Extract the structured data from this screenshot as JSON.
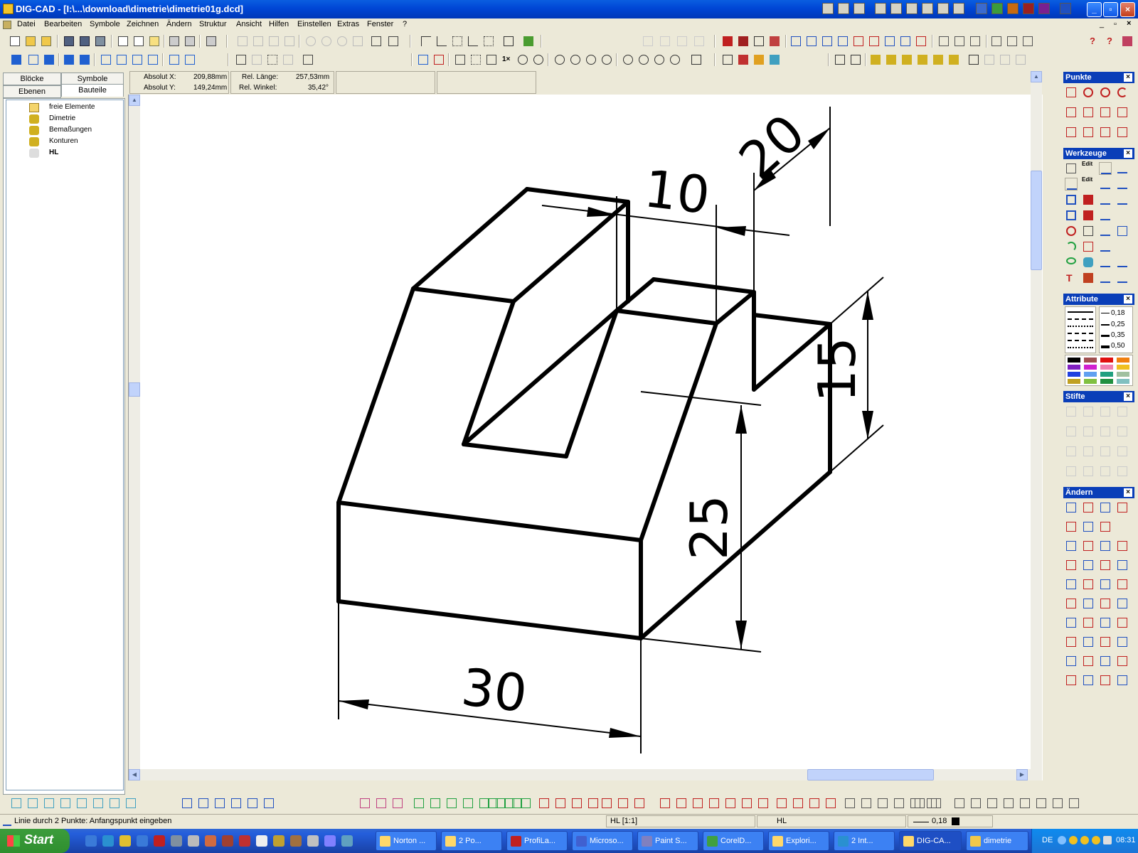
{
  "window": {
    "title": "DIG-CAD - [I:\\...\\download\\dimetrie\\dimetrie01g.dcd]"
  },
  "menu": [
    "Datei",
    "Bearbeiten",
    "Symbole",
    "Zeichnen",
    "Ändern",
    "Struktur",
    "Ansicht",
    "Hilfen",
    "Einstellen",
    "Extras",
    "Fenster",
    "?"
  ],
  "panel": {
    "tabs": [
      "Blöcke",
      "Symbole",
      "Ebenen",
      "Bauteile"
    ],
    "tree": [
      "freie Elemente",
      "Dimetrie",
      "Bemaßungen",
      "Konturen",
      "HL"
    ]
  },
  "coords": {
    "abs_x_label": "Absolut X:",
    "abs_x": "209,88mm",
    "abs_y_label": "Absolut Y:",
    "abs_y": "149,24mm",
    "rel_len_label": "Rel. Länge:",
    "rel_len": "257,53mm",
    "rel_ang_label": "Rel. Winkel:",
    "rel_ang": "35,42°"
  },
  "drawing": {
    "dim_30": "30",
    "dim_25": "25",
    "dim_10": "10",
    "dim_20": "20",
    "dim_15": "15"
  },
  "palettes": {
    "punkte": "Punkte",
    "werkzeuge": "Werkzeuge",
    "attribute": "Attribute",
    "stifte": "Stifte",
    "aendern": "Ändern",
    "edit1": "Edit",
    "edit2": "Edit",
    "linewidths": [
      "0,18",
      "0,25",
      "0,35",
      "0,50"
    ],
    "swatches": [
      "#000000",
      "#a05050",
      "#e01010",
      "#f08010",
      "#8020c0",
      "#d020d0",
      "#f080b0",
      "#f0c020",
      "#2040e0",
      "#60a0f0",
      "#20a080",
      "#a0c0a0",
      "#c0a020",
      "#80c040",
      "#209040",
      "#80c0c0"
    ]
  },
  "status": {
    "prompt": "Linie durch 2 Punkte: Anfangspunkt eingeben",
    "layer": "HL [1:1]",
    "pen": "HL",
    "width": "0,18"
  },
  "taskbar": {
    "start": "Start",
    "tasks": [
      "Norton ...",
      "2 Po...",
      "ProfiLa...",
      "Microso...",
      "Paint S...",
      "CorelD...",
      "Explori...",
      "2 Int...",
      "DIG-CA...",
      "dimetrie"
    ],
    "lang": "DE",
    "time": "08:31"
  },
  "colors": {
    "titlebar": "#0046d5",
    "accent": "#0a3eb8",
    "taskbar": "#245edb"
  }
}
